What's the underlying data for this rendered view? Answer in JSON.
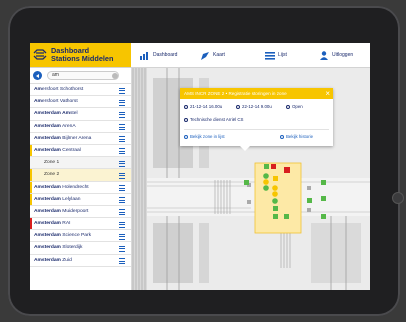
{
  "header": {
    "brand_line1": "Dashboard",
    "brand_line2": "Stations Middelen",
    "tabs": [
      {
        "label": "Dashboard",
        "icon": "bar-chart-icon"
      },
      {
        "label": "Kaart",
        "icon": "map-pin-icon"
      },
      {
        "label": "Lijst",
        "icon": "list-icon"
      },
      {
        "label": "Uitloggen",
        "icon": "user-icon"
      }
    ]
  },
  "search": {
    "value": "am"
  },
  "stations": [
    {
      "bold": "Am",
      "rest": "ersfoort Schothorst"
    },
    {
      "bold": "Am",
      "rest": "ersfoort Vathorst"
    },
    {
      "bold": "Amsterdam Am",
      "rest": "stel"
    },
    {
      "bold": "Amsterdam",
      "rest": " ArenA"
    },
    {
      "bold": "Amsterdam",
      "rest": " Bijlmer Arena"
    },
    {
      "bold": "Amsterdam",
      "rest": " Centraal"
    },
    {
      "label": "Zone 1"
    },
    {
      "label": "Zone 2"
    },
    {
      "bold": "Amsterdam",
      "rest": " Holendrecht"
    },
    {
      "bold": "Amsterdam",
      "rest": " Lelylaan"
    },
    {
      "bold": "Amsterdam",
      "rest": " Muiderpoort"
    },
    {
      "bold": "Amsterdam",
      "rest": " RAI"
    },
    {
      "bold": "Amsterdam",
      "rest": " Science Park"
    },
    {
      "bold": "Amsterdam",
      "rest": " Sloterdijk"
    },
    {
      "bold": "Amsterdam",
      "rest": " Zuid"
    }
  ],
  "popup": {
    "title": "AMS INCR ZONE 2 • Registratie storingen in zone",
    "time_start": "21-12-14 16.00u",
    "time_end": "22-12-14 9.00u",
    "status": "Open",
    "service": "Technische dienst Arriël CS",
    "link_zone": "Bekijk zone in lijst",
    "link_history": "Bekijk historie"
  },
  "colors": {
    "brand": "#f7c500",
    "primary": "#1b5fbd",
    "text": "#1a2a6c",
    "alert": "#d81e1e",
    "ok": "#55b848"
  }
}
